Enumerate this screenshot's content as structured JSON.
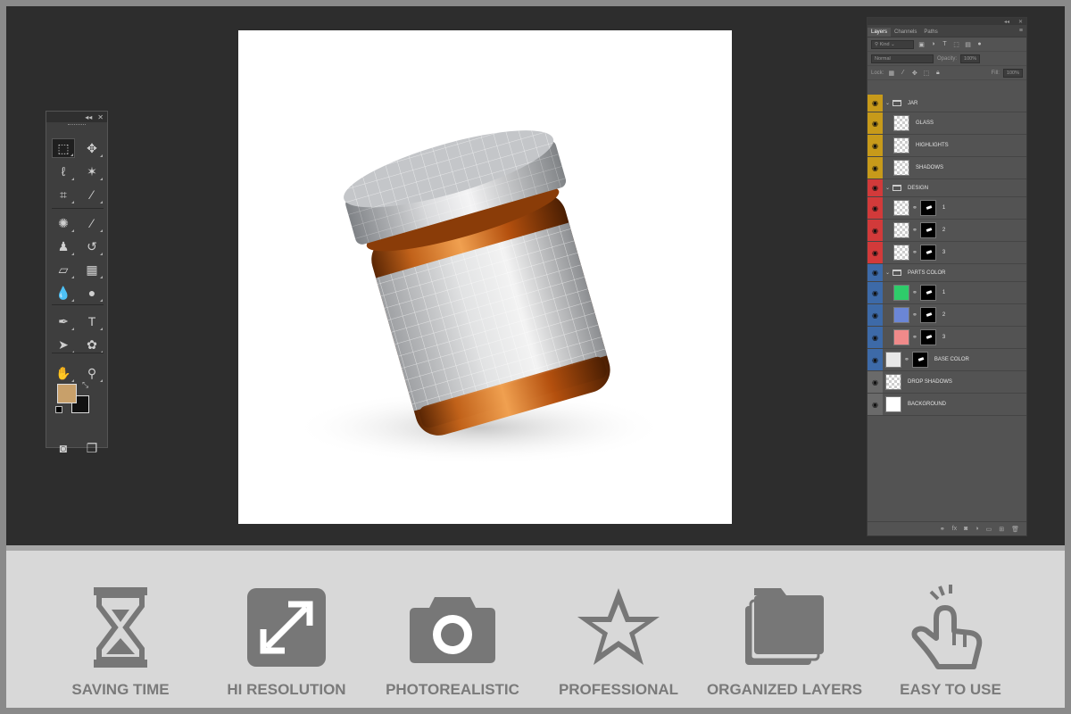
{
  "toolbar": {
    "collapse_glyph": "◂◂",
    "close_glyph": "✕",
    "foreground_color": "#c8a06a",
    "background_color": "#111111",
    "tools": [
      {
        "name": "rectangular-marquee-tool",
        "glyph": "⬚"
      },
      {
        "name": "move-tool",
        "glyph": "✥"
      },
      {
        "name": "lasso-tool",
        "glyph": "ℓ"
      },
      {
        "name": "magic-wand-tool",
        "glyph": "✶"
      },
      {
        "name": "crop-tool",
        "glyph": "⌗"
      },
      {
        "name": "eyedropper-tool",
        "glyph": "⁄"
      },
      {
        "name": "spot-healing-tool",
        "glyph": "✺"
      },
      {
        "name": "brush-tool",
        "glyph": "⁄"
      },
      {
        "name": "clone-stamp-tool",
        "glyph": "♟"
      },
      {
        "name": "history-brush-tool",
        "glyph": "↺"
      },
      {
        "name": "eraser-tool",
        "glyph": "▱"
      },
      {
        "name": "gradient-tool",
        "glyph": "▦"
      },
      {
        "name": "blur-tool",
        "glyph": "💧"
      },
      {
        "name": "dodge-tool",
        "glyph": "●"
      },
      {
        "name": "pen-tool",
        "glyph": "✒"
      },
      {
        "name": "type-tool",
        "glyph": "T"
      },
      {
        "name": "path-selection-tool",
        "glyph": "➤"
      },
      {
        "name": "custom-shape-tool",
        "glyph": "✿"
      },
      {
        "name": "hand-tool",
        "glyph": "✋"
      },
      {
        "name": "zoom-tool",
        "glyph": "⚲"
      },
      {
        "name": "quick-mask-button",
        "glyph": "◙"
      },
      {
        "name": "screen-mode-button",
        "glyph": "❐"
      }
    ]
  },
  "layers_panel": {
    "tabs": [
      "Layers",
      "Channels",
      "Paths"
    ],
    "filter_kind": "Kind",
    "blend_mode": "Normal",
    "opacity_label": "Opacity:",
    "opacity_value": "100%",
    "lock_label": "Lock:",
    "fill_label": "Fill:",
    "fill_value": "100%",
    "layers": [
      {
        "name": "JAR",
        "type": "group",
        "color": "#c79a1a"
      },
      {
        "name": "GLASS",
        "type": "layer",
        "color": "#c79a1a",
        "indent": true
      },
      {
        "name": "HIGHLIGHTS",
        "type": "layer",
        "color": "#c79a1a",
        "indent": true
      },
      {
        "name": "SHADOWS",
        "type": "layer",
        "color": "#c79a1a",
        "indent": true
      },
      {
        "name": "DESIGN",
        "type": "group",
        "color": "#d23a3a"
      },
      {
        "name": "1",
        "type": "masked",
        "color": "#d23a3a",
        "indent": true
      },
      {
        "name": "2",
        "type": "masked",
        "color": "#d23a3a",
        "indent": true
      },
      {
        "name": "3",
        "type": "masked",
        "color": "#d23a3a",
        "indent": true
      },
      {
        "name": "PARTS COLOR",
        "type": "group",
        "color": "#3d6aa8"
      },
      {
        "name": "1",
        "type": "color",
        "color": "#3d6aa8",
        "fill": "#2ecc6a",
        "indent": true
      },
      {
        "name": "2",
        "type": "color",
        "color": "#3d6aa8",
        "fill": "#6b86d6",
        "indent": true
      },
      {
        "name": "3",
        "type": "color",
        "color": "#3d6aa8",
        "fill": "#f08a8a",
        "indent": true
      },
      {
        "name": "BASE COLOR",
        "type": "color",
        "color": "#3d6aa8",
        "fill": "#e8e8e8"
      },
      {
        "name": "DROP SHADOWS",
        "type": "layer",
        "color": "#6a6a6a"
      },
      {
        "name": "BACKGROUND",
        "type": "white",
        "color": "#6a6a6a"
      }
    ]
  },
  "features": [
    {
      "label": "SAVING TIME",
      "icon": "hourglass-icon"
    },
    {
      "label": "HI RESOLUTION",
      "icon": "resize-icon"
    },
    {
      "label": "PHOTOREALISTIC",
      "icon": "camera-icon"
    },
    {
      "label": "PROFESSIONAL",
      "icon": "star-icon"
    },
    {
      "label": "ORGANIZED LAYERS",
      "icon": "folders-icon"
    },
    {
      "label": "EASY TO USE",
      "icon": "hand-tap-icon"
    }
  ],
  "colors": {
    "feature_icon": "#777777",
    "workspace": "#2d2d2d",
    "jar_amber": "#b8560f"
  }
}
